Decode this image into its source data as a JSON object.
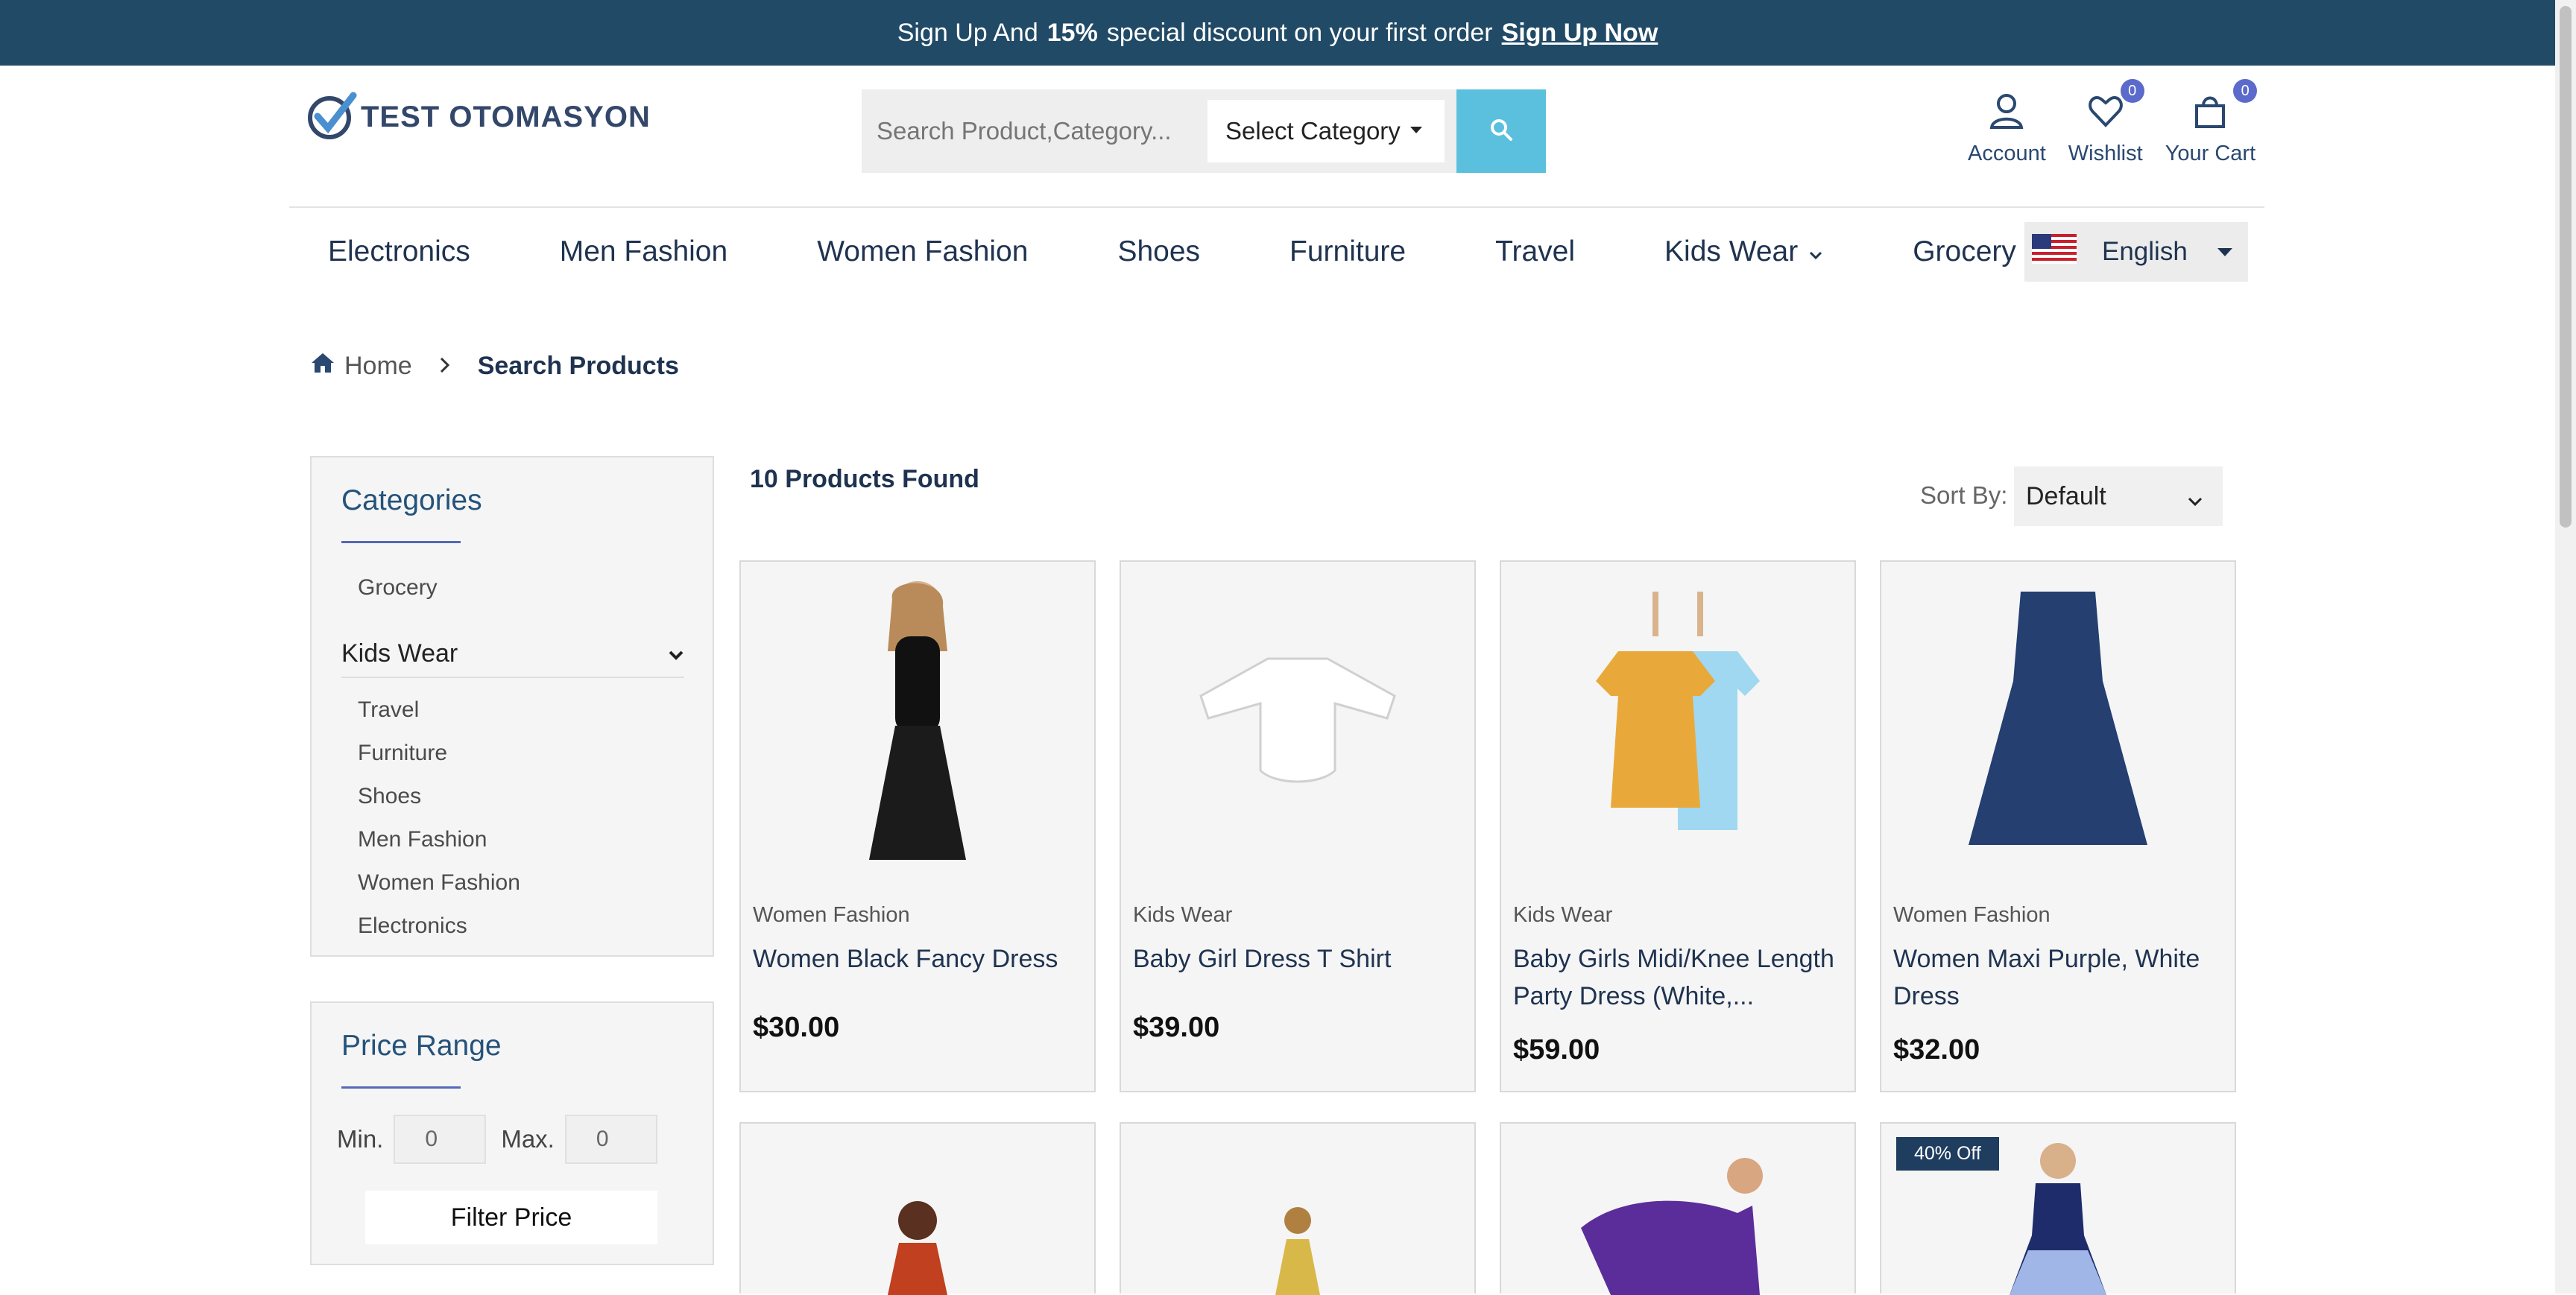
{
  "announcement": {
    "prefix": "Sign Up And",
    "percent": "15%",
    "middle": "special discount on your first order",
    "link": "Sign Up Now"
  },
  "logo": {
    "text": "TEST OTOMASYON"
  },
  "search": {
    "placeholder": "Search Product,Category...",
    "category_label": "Select Category"
  },
  "header_icons": {
    "account_label": "Account",
    "wishlist_label": "Wishlist",
    "wishlist_count": "0",
    "cart_label": "Your Cart",
    "cart_count": "0"
  },
  "nav": {
    "items": [
      "Electronics",
      "Men Fashion",
      "Women Fashion",
      "Shoes",
      "Furniture",
      "Travel",
      "Kids Wear",
      "Grocery"
    ]
  },
  "language": {
    "label": "English"
  },
  "breadcrumb": {
    "home": "Home",
    "current": "Search Products"
  },
  "categories": {
    "title": "Categories",
    "top": "Grocery",
    "expanded": "Kids Wear",
    "items": [
      "Travel",
      "Furniture",
      "Shoes",
      "Men Fashion",
      "Women Fashion",
      "Electronics"
    ]
  },
  "price_range": {
    "title": "Price Range",
    "min_label": "Min.",
    "min_value": "0",
    "max_label": "Max.",
    "max_value": "0",
    "button": "Filter Price"
  },
  "results": {
    "found": "10 Products Found",
    "sort_label": "Sort By:",
    "sort_value": "Default"
  },
  "products": [
    {
      "category": "Women Fashion",
      "name": "Women Black Fancy Dress",
      "price": "$30.00"
    },
    {
      "category": "Kids Wear",
      "name": "Baby Girl Dress T Shirt",
      "price": "$39.00"
    },
    {
      "category": "Kids Wear",
      "name": "Baby Girls Midi/Knee Length Party Dress (White,...",
      "price": "$59.00"
    },
    {
      "category": "Women Fashion",
      "name": "Women Maxi Purple, White Dress",
      "price": "$32.00"
    }
  ],
  "second_row": {
    "badge": "40% Off"
  },
  "colors": {
    "topbar": "#214a66",
    "accent": "#5bc0de",
    "badge": "#5b6acb",
    "title": "#24527a"
  }
}
